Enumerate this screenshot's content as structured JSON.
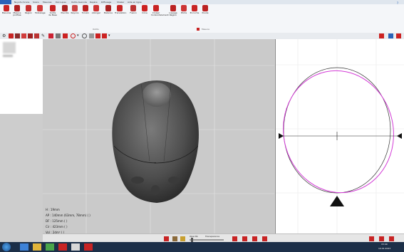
{
  "ribbon": {
    "file_tab": "",
    "tabs": [
      "Nuyohu Scans",
      "Scans",
      "Mesures",
      "Découpes",
      "Outils Avancés",
      "Repère",
      "Diffusage",
      "Shaker",
      "Aide en ligne"
    ],
    "buttons": [
      {
        "label": "Mesures",
        "icon": "ruler-icon"
      },
      {
        "label": "Mesure\nprofilée",
        "icon": "profile-measure-icon"
      },
      {
        "label": "Région",
        "icon": "region-icon"
      },
      {
        "label": "Modelage",
        "icon": "modeling-icon"
      },
      {
        "label": "Outils\nde Base",
        "icon": "base-tools-icon"
      },
      {
        "label": "Piecote",
        "icon": "pin-icon"
      },
      {
        "label": "Rayons",
        "icon": "radius-icon"
      },
      {
        "label": "Torsion",
        "icon": "torsion-icon"
      },
      {
        "label": "Allonger",
        "icon": "stretch-icon"
      },
      {
        "label": "Balance",
        "icon": "balance-icon"
      },
      {
        "label": "Translation",
        "icon": "translate-icon"
      },
      {
        "label": "Fusion",
        "icon": "fusion-icon"
      },
      {
        "label": "Cône",
        "icon": "cone-icon"
      },
      {
        "label": "Croiser\nhorizontalement",
        "icon": "cross-icon"
      },
      {
        "label": "Lissage\nRégion",
        "icon": "smooth-region-icon"
      },
      {
        "label": "Plinte",
        "icon": "plinth-icon"
      },
      {
        "label": "Encoche",
        "icon": "notch-icon"
      },
      {
        "label": "Poulie",
        "icon": "pulley-icon"
      }
    ],
    "group_outils": "Outils",
    "group_mesure": "Mesure"
  },
  "measurements": {
    "h": "H : 19mm",
    "ap_prefix": "AP : 140mm (63mm, 78mm) ( ",
    "ap_hl": "           ",
    "ap_suffix": " )",
    "df_prefix": "DF : 125mm ( ",
    "df_hl": "           ",
    "df_suffix": " )",
    "cir_prefix": "Cir : 423mm ( ",
    "cir_hl": "           ",
    "cir_suffix": " )",
    "vol_prefix": "Vol : 2dm³ ( ",
    "vol_hl": "       ",
    "vol_suffix": " )"
  },
  "bottombar": {
    "opacite": "Opacité",
    "transparence": "Transparence"
  },
  "taskbar": {
    "time": "15:40",
    "date": "10.01.2023"
  },
  "colors": {
    "accent_red": "#c82424",
    "file_tab_blue": "#2a63b8",
    "outline_magenta": "#d33bd6",
    "measure_highlight": "#3aa7b0"
  }
}
